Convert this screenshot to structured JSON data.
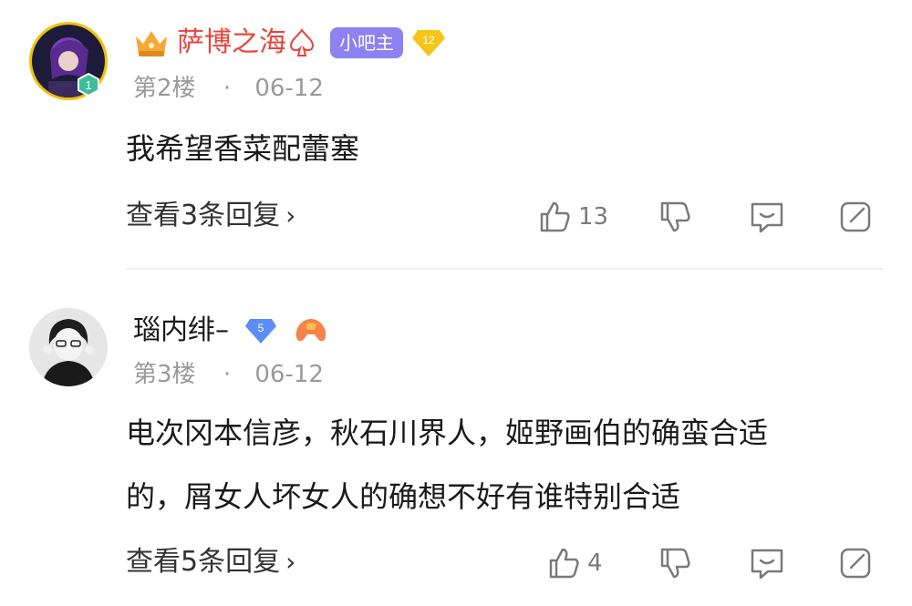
{
  "posts": [
    {
      "username": "萨博之海",
      "role_badge": "小吧主",
      "level": "12",
      "avatar_level": "1",
      "floor": "第2楼",
      "date": "06-12",
      "content_lines": [
        "我希望香菜配蕾塞"
      ],
      "reply_link": "查看3条回复",
      "likes": "13",
      "colors": {
        "username": "#e8453c",
        "pill": "#8c82f2",
        "level_badge": "#f5c518"
      }
    },
    {
      "username": "瑙内绯–",
      "level": "5",
      "floor": "第3楼",
      "date": "06-12",
      "content_lines": [
        "电次冈本信彦，秋石川界人，姬野画伯的确蛮合适",
        "的，屑女人坏女人的确想不好有谁特别合适"
      ],
      "reply_link": "查看5条回复",
      "likes": "4",
      "colors": {
        "username": "#1a1a1a",
        "level_badge": "#5b8ef5"
      }
    }
  ],
  "meta_separator": "·",
  "chevron": "›"
}
